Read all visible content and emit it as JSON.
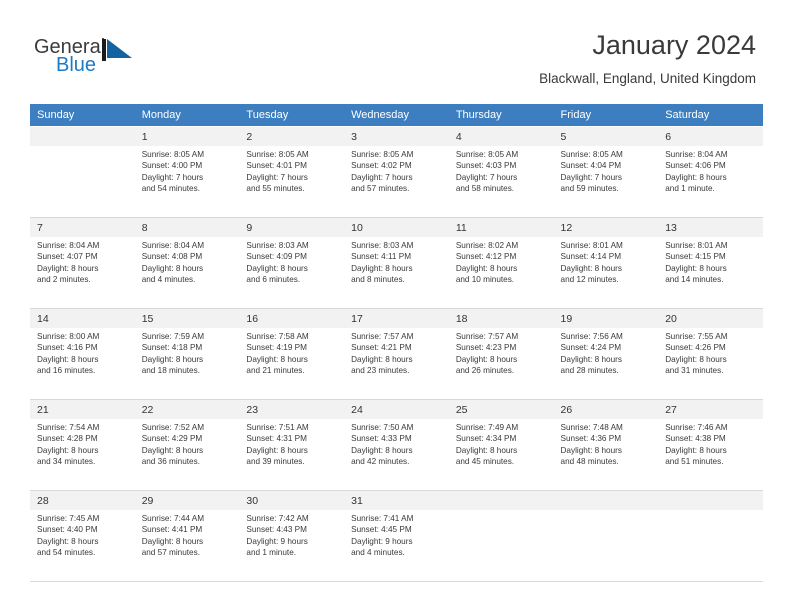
{
  "brand": {
    "name_part1": "General",
    "name_part2": "Blue",
    "mark": "triangle-flag-icon",
    "accent_color": "#1f7ac4"
  },
  "header": {
    "title": "January 2024",
    "location": "Blackwall, England, United Kingdom"
  },
  "calendar": {
    "header_bg": "#3c7ebf",
    "daynum_bg": "#f2f2f2",
    "weekday_headers": [
      "Sunday",
      "Monday",
      "Tuesday",
      "Wednesday",
      "Thursday",
      "Friday",
      "Saturday"
    ],
    "weeks": [
      [
        {
          "day": "",
          "lines": []
        },
        {
          "day": "1",
          "lines": [
            "Sunrise: 8:05 AM",
            "Sunset: 4:00 PM",
            "Daylight: 7 hours",
            "and 54 minutes."
          ]
        },
        {
          "day": "2",
          "lines": [
            "Sunrise: 8:05 AM",
            "Sunset: 4:01 PM",
            "Daylight: 7 hours",
            "and 55 minutes."
          ]
        },
        {
          "day": "3",
          "lines": [
            "Sunrise: 8:05 AM",
            "Sunset: 4:02 PM",
            "Daylight: 7 hours",
            "and 57 minutes."
          ]
        },
        {
          "day": "4",
          "lines": [
            "Sunrise: 8:05 AM",
            "Sunset: 4:03 PM",
            "Daylight: 7 hours",
            "and 58 minutes."
          ]
        },
        {
          "day": "5",
          "lines": [
            "Sunrise: 8:05 AM",
            "Sunset: 4:04 PM",
            "Daylight: 7 hours",
            "and 59 minutes."
          ]
        },
        {
          "day": "6",
          "lines": [
            "Sunrise: 8:04 AM",
            "Sunset: 4:06 PM",
            "Daylight: 8 hours",
            "and 1 minute."
          ]
        }
      ],
      [
        {
          "day": "7",
          "lines": [
            "Sunrise: 8:04 AM",
            "Sunset: 4:07 PM",
            "Daylight: 8 hours",
            "and 2 minutes."
          ]
        },
        {
          "day": "8",
          "lines": [
            "Sunrise: 8:04 AM",
            "Sunset: 4:08 PM",
            "Daylight: 8 hours",
            "and 4 minutes."
          ]
        },
        {
          "day": "9",
          "lines": [
            "Sunrise: 8:03 AM",
            "Sunset: 4:09 PM",
            "Daylight: 8 hours",
            "and 6 minutes."
          ]
        },
        {
          "day": "10",
          "lines": [
            "Sunrise: 8:03 AM",
            "Sunset: 4:11 PM",
            "Daylight: 8 hours",
            "and 8 minutes."
          ]
        },
        {
          "day": "11",
          "lines": [
            "Sunrise: 8:02 AM",
            "Sunset: 4:12 PM",
            "Daylight: 8 hours",
            "and 10 minutes."
          ]
        },
        {
          "day": "12",
          "lines": [
            "Sunrise: 8:01 AM",
            "Sunset: 4:14 PM",
            "Daylight: 8 hours",
            "and 12 minutes."
          ]
        },
        {
          "day": "13",
          "lines": [
            "Sunrise: 8:01 AM",
            "Sunset: 4:15 PM",
            "Daylight: 8 hours",
            "and 14 minutes."
          ]
        }
      ],
      [
        {
          "day": "14",
          "lines": [
            "Sunrise: 8:00 AM",
            "Sunset: 4:16 PM",
            "Daylight: 8 hours",
            "and 16 minutes."
          ]
        },
        {
          "day": "15",
          "lines": [
            "Sunrise: 7:59 AM",
            "Sunset: 4:18 PM",
            "Daylight: 8 hours",
            "and 18 minutes."
          ]
        },
        {
          "day": "16",
          "lines": [
            "Sunrise: 7:58 AM",
            "Sunset: 4:19 PM",
            "Daylight: 8 hours",
            "and 21 minutes."
          ]
        },
        {
          "day": "17",
          "lines": [
            "Sunrise: 7:57 AM",
            "Sunset: 4:21 PM",
            "Daylight: 8 hours",
            "and 23 minutes."
          ]
        },
        {
          "day": "18",
          "lines": [
            "Sunrise: 7:57 AM",
            "Sunset: 4:23 PM",
            "Daylight: 8 hours",
            "and 26 minutes."
          ]
        },
        {
          "day": "19",
          "lines": [
            "Sunrise: 7:56 AM",
            "Sunset: 4:24 PM",
            "Daylight: 8 hours",
            "and 28 minutes."
          ]
        },
        {
          "day": "20",
          "lines": [
            "Sunrise: 7:55 AM",
            "Sunset: 4:26 PM",
            "Daylight: 8 hours",
            "and 31 minutes."
          ]
        }
      ],
      [
        {
          "day": "21",
          "lines": [
            "Sunrise: 7:54 AM",
            "Sunset: 4:28 PM",
            "Daylight: 8 hours",
            "and 34 minutes."
          ]
        },
        {
          "day": "22",
          "lines": [
            "Sunrise: 7:52 AM",
            "Sunset: 4:29 PM",
            "Daylight: 8 hours",
            "and 36 minutes."
          ]
        },
        {
          "day": "23",
          "lines": [
            "Sunrise: 7:51 AM",
            "Sunset: 4:31 PM",
            "Daylight: 8 hours",
            "and 39 minutes."
          ]
        },
        {
          "day": "24",
          "lines": [
            "Sunrise: 7:50 AM",
            "Sunset: 4:33 PM",
            "Daylight: 8 hours",
            "and 42 minutes."
          ]
        },
        {
          "day": "25",
          "lines": [
            "Sunrise: 7:49 AM",
            "Sunset: 4:34 PM",
            "Daylight: 8 hours",
            "and 45 minutes."
          ]
        },
        {
          "day": "26",
          "lines": [
            "Sunrise: 7:48 AM",
            "Sunset: 4:36 PM",
            "Daylight: 8 hours",
            "and 48 minutes."
          ]
        },
        {
          "day": "27",
          "lines": [
            "Sunrise: 7:46 AM",
            "Sunset: 4:38 PM",
            "Daylight: 8 hours",
            "and 51 minutes."
          ]
        }
      ],
      [
        {
          "day": "28",
          "lines": [
            "Sunrise: 7:45 AM",
            "Sunset: 4:40 PM",
            "Daylight: 8 hours",
            "and 54 minutes."
          ]
        },
        {
          "day": "29",
          "lines": [
            "Sunrise: 7:44 AM",
            "Sunset: 4:41 PM",
            "Daylight: 8 hours",
            "and 57 minutes."
          ]
        },
        {
          "day": "30",
          "lines": [
            "Sunrise: 7:42 AM",
            "Sunset: 4:43 PM",
            "Daylight: 9 hours",
            "and 1 minute."
          ]
        },
        {
          "day": "31",
          "lines": [
            "Sunrise: 7:41 AM",
            "Sunset: 4:45 PM",
            "Daylight: 9 hours",
            "and 4 minutes."
          ]
        },
        {
          "day": "",
          "lines": []
        },
        {
          "day": "",
          "lines": []
        },
        {
          "day": "",
          "lines": []
        }
      ]
    ]
  }
}
